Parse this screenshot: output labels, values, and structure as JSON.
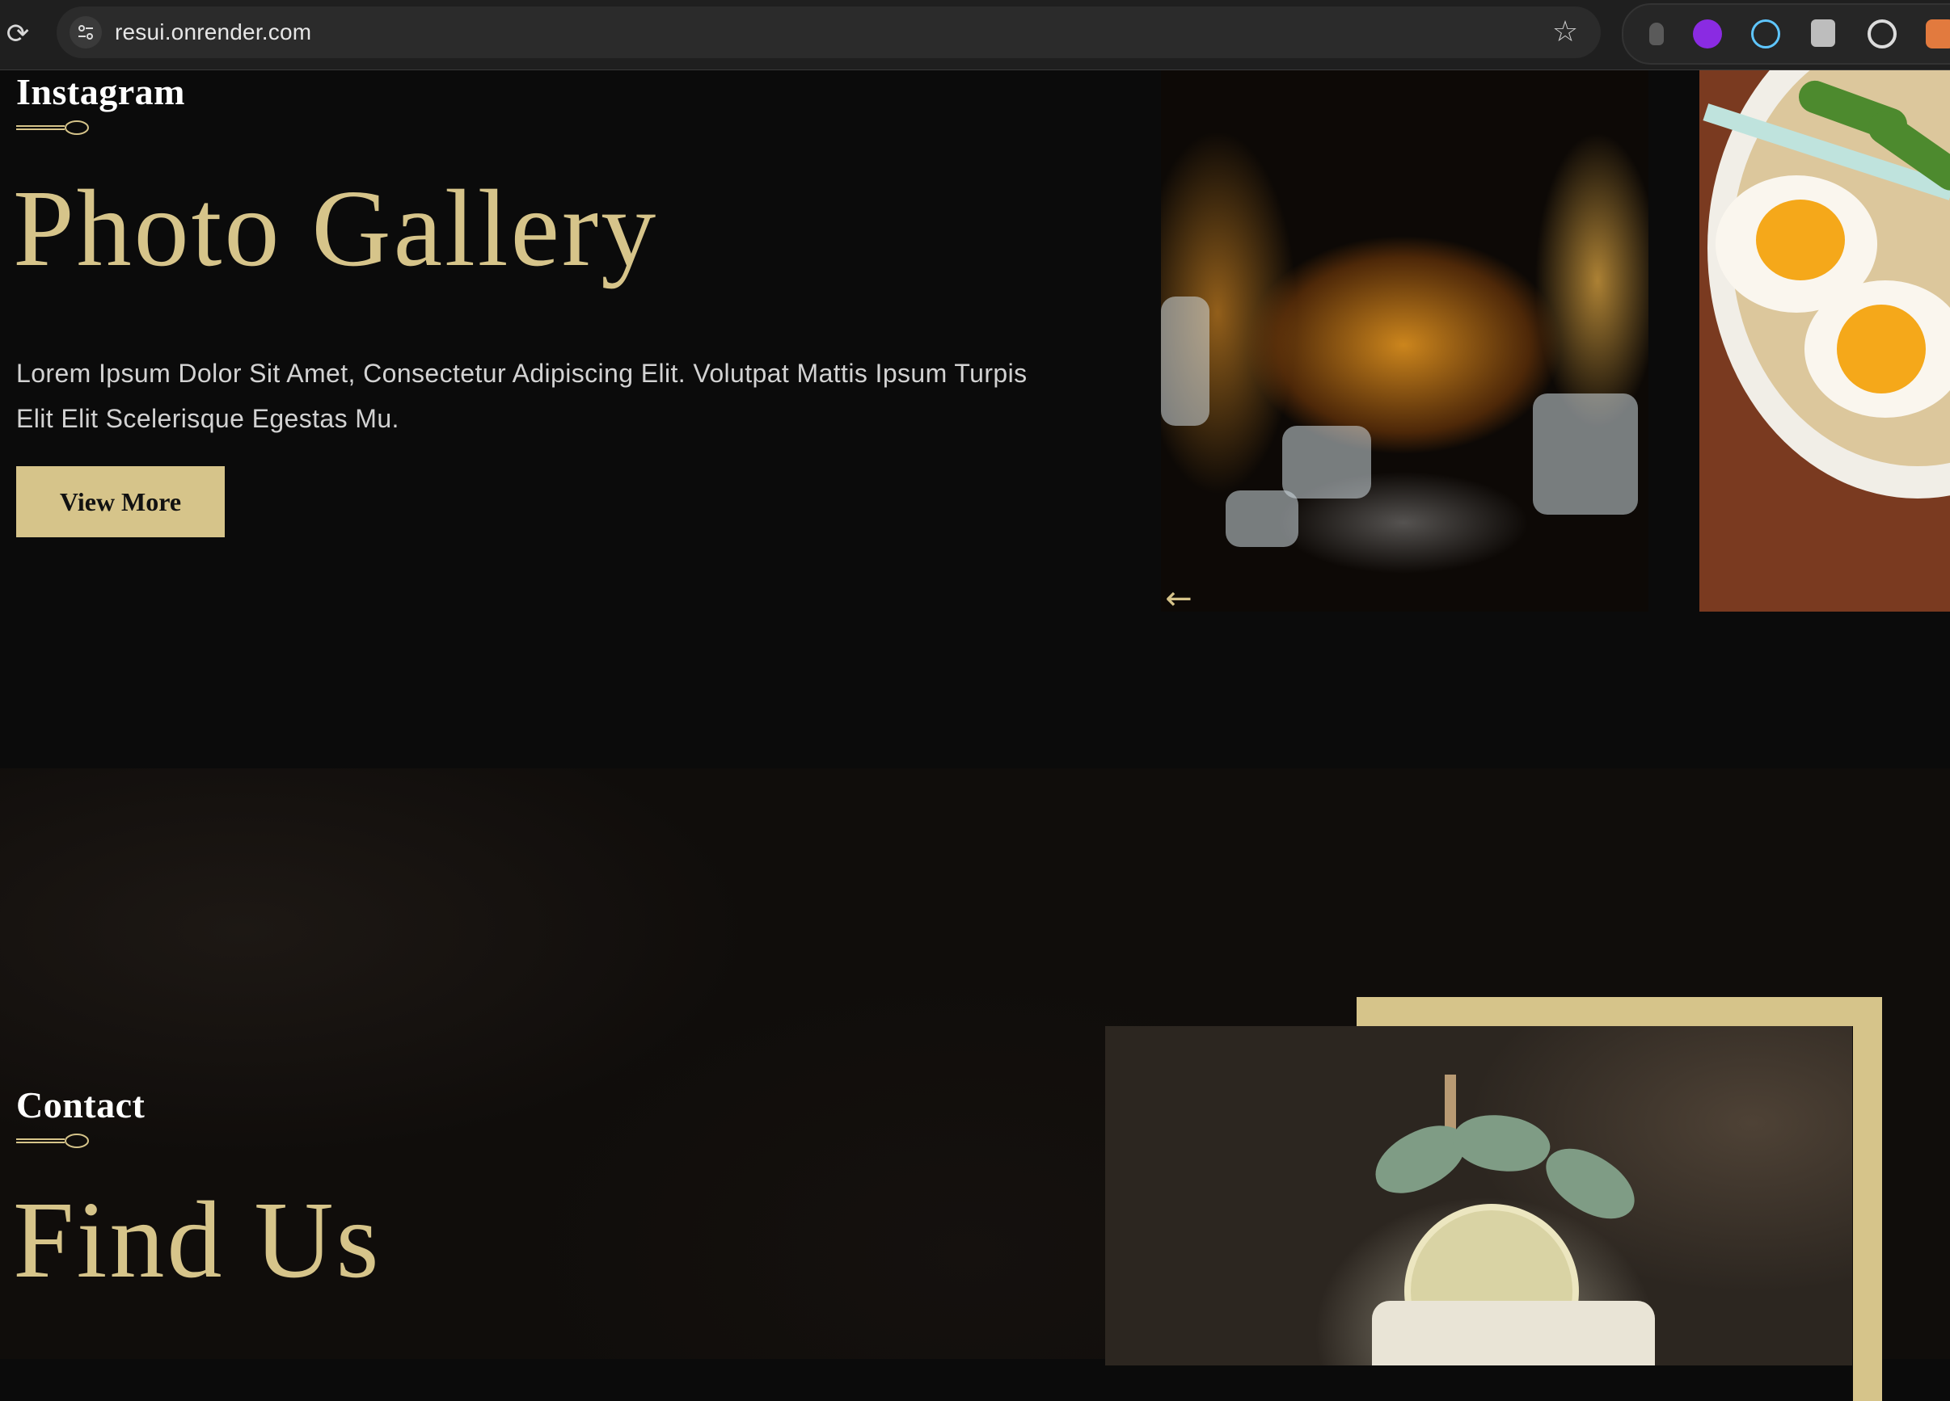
{
  "browser": {
    "reload_icon": "reload-icon",
    "url": "resui.onrender.com",
    "bookmark_icon": "star-icon",
    "extensions": [
      "extension-1",
      "extension-2",
      "react-devtools",
      "extension-4",
      "extension-5",
      "extension-6"
    ]
  },
  "gallery": {
    "eyebrow": "Instagram",
    "title": "Photo Gallery",
    "description": "Lorem Ipsum Dolor Sit Amet, Consectetur Adipiscing Elit. Volutpat Mattis Ipsum Turpis Elit Elit Scelerisque Egestas Mu.",
    "button_label": "View More",
    "prev_arrow": "←",
    "photos": [
      "whiskey-glass-photo",
      "ramen-bowl-photo"
    ]
  },
  "contact": {
    "eyebrow": "Contact",
    "title": "Find Us",
    "photo": "mint-cocktail-photo"
  },
  "colors": {
    "accent": "#d6c48a",
    "background": "#0b0b0b",
    "heading": "#ffffff"
  }
}
